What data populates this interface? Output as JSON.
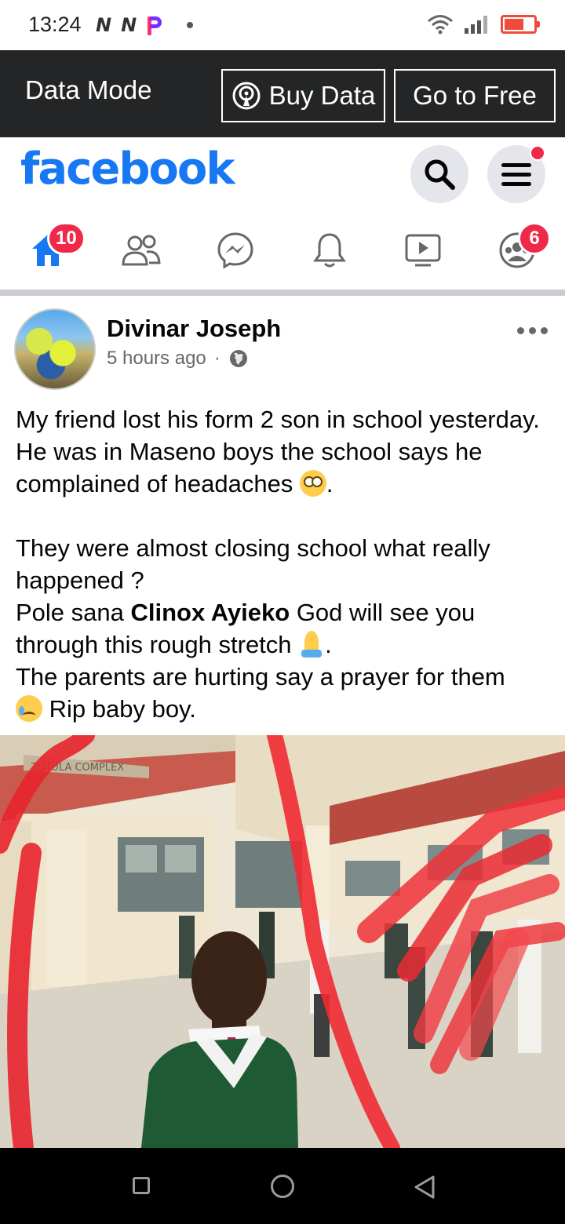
{
  "status_bar": {
    "time": "13:24",
    "left_icons": [
      "n-news-icon",
      "n-news-icon",
      "picsart-p-icon",
      "notification-dot"
    ],
    "right_icons": [
      "wifi-icon",
      "signal-icon",
      "battery-icon"
    ],
    "battery_color": "#f04a3a"
  },
  "data_mode": {
    "label": "Data Mode",
    "buy_data_label": "Buy Data",
    "go_to_free_label": "Go to Free"
  },
  "header": {
    "logo": "facebook",
    "brand_color": "#1877f2",
    "search_icon": "search-icon",
    "menu_icon": "hamburger-menu-icon"
  },
  "nav": {
    "tabs": [
      {
        "name": "home",
        "icon": "home-icon",
        "badge": "10",
        "active": true
      },
      {
        "name": "friends",
        "icon": "friends-icon",
        "badge": null
      },
      {
        "name": "messenger",
        "icon": "messenger-icon",
        "badge": null
      },
      {
        "name": "notifications",
        "icon": "bell-icon",
        "badge": null
      },
      {
        "name": "watch",
        "icon": "video-icon",
        "badge": null
      },
      {
        "name": "groups",
        "icon": "groups-icon",
        "badge": "6"
      }
    ]
  },
  "post": {
    "author": "Divinar Joseph",
    "time": "5 hours ago",
    "separator": "·",
    "privacy_icon": "globe-icon",
    "text": {
      "line1": "My friend lost his form 2 son in school yesterday.  He was in Maseno boys the school says he complained of headaches ",
      "line1_end": ".",
      "line2": "They were almost closing school what  really happened ?",
      "line3_start": "Pole sana ",
      "line3_tag": "Clinox Ayieko",
      "line3_end": "  God will see you through this rough stretch ",
      "line3_tail": ".",
      "line4": "The parents are hurting say a prayer for them",
      "line5": " Rip baby boy."
    },
    "photo_sign_text": "TUTULA COMPLEX"
  },
  "android_nav": {
    "buttons": [
      "recents-button",
      "home-button",
      "back-button"
    ]
  }
}
